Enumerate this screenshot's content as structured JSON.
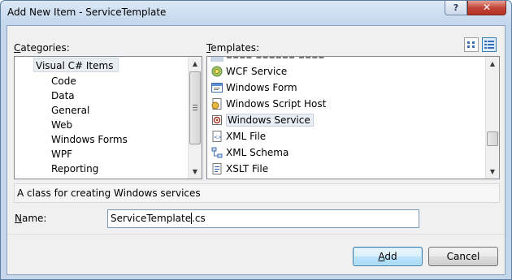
{
  "window": {
    "title": "Add New Item - ServiceTemplate",
    "help_label": "?",
    "close_label": "✕"
  },
  "categories": {
    "label_accel": "C",
    "label_rest": "ategories:",
    "items": [
      {
        "label": "Visual C# Items"
      },
      {
        "label": "Code"
      },
      {
        "label": "Data"
      },
      {
        "label": "General"
      },
      {
        "label": "Web"
      },
      {
        "label": "Windows Forms"
      },
      {
        "label": "WPF"
      },
      {
        "label": "Reporting"
      }
    ]
  },
  "templates": {
    "label_accel": "T",
    "label_rest": "emplates:",
    "items": [
      {
        "label": "WCF Service",
        "icon": "wcf-service-icon"
      },
      {
        "label": "Windows Form",
        "icon": "windows-form-icon"
      },
      {
        "label": "Windows Script Host",
        "icon": "script-host-icon"
      },
      {
        "label": "Windows Service",
        "icon": "windows-service-icon"
      },
      {
        "label": "XML File",
        "icon": "xml-file-icon"
      },
      {
        "label": "XML Schema",
        "icon": "xml-schema-icon"
      },
      {
        "label": "XSLT File",
        "icon": "xslt-file-icon"
      }
    ],
    "selected": "Windows Service"
  },
  "description": "A class for creating Windows services",
  "name": {
    "label_accel": "N",
    "label_rest": "ame:",
    "value_before_caret": "ServiceTemplate",
    "value_after_caret": ".cs"
  },
  "buttons": {
    "add_accel": "A",
    "add_rest": "dd",
    "cancel": "Cancel"
  },
  "colors": {
    "title_bar": "#c2d6ec",
    "close_button": "#c0463a",
    "default_button_border": "#3c7fb1"
  }
}
